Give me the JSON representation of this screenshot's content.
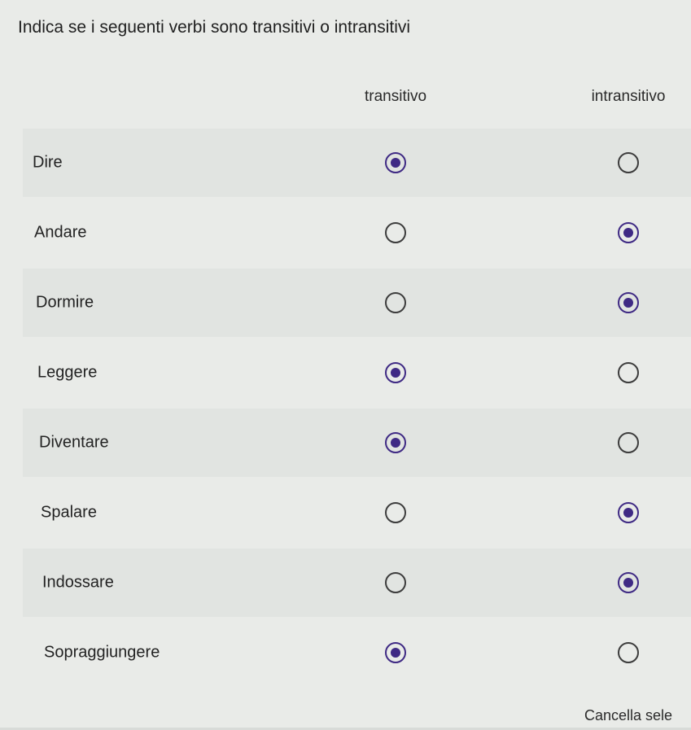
{
  "question": {
    "title": "Indica se i seguenti verbi sono transitivi o intransitivi",
    "columns": [
      "transitivo",
      "intransitivo"
    ],
    "rows": [
      {
        "label": "Dire",
        "selected": "transitivo"
      },
      {
        "label": "Andare",
        "selected": "intransitivo"
      },
      {
        "label": "Dormire",
        "selected": "intransitivo"
      },
      {
        "label": "Leggere",
        "selected": "transitivo"
      },
      {
        "label": "Diventare",
        "selected": "transitivo"
      },
      {
        "label": "Spalare",
        "selected": "intransitivo"
      },
      {
        "label": "Indossare",
        "selected": "intransitivo"
      },
      {
        "label": "Sopraggiungere",
        "selected": "transitivo"
      }
    ],
    "clear_label": "Cancella sele"
  },
  "colors": {
    "background": "#e9ebe8",
    "row_shade": "#e1e4e1",
    "radio_selected": "#3f2a84",
    "radio_unselected": "#3c3c3c"
  }
}
